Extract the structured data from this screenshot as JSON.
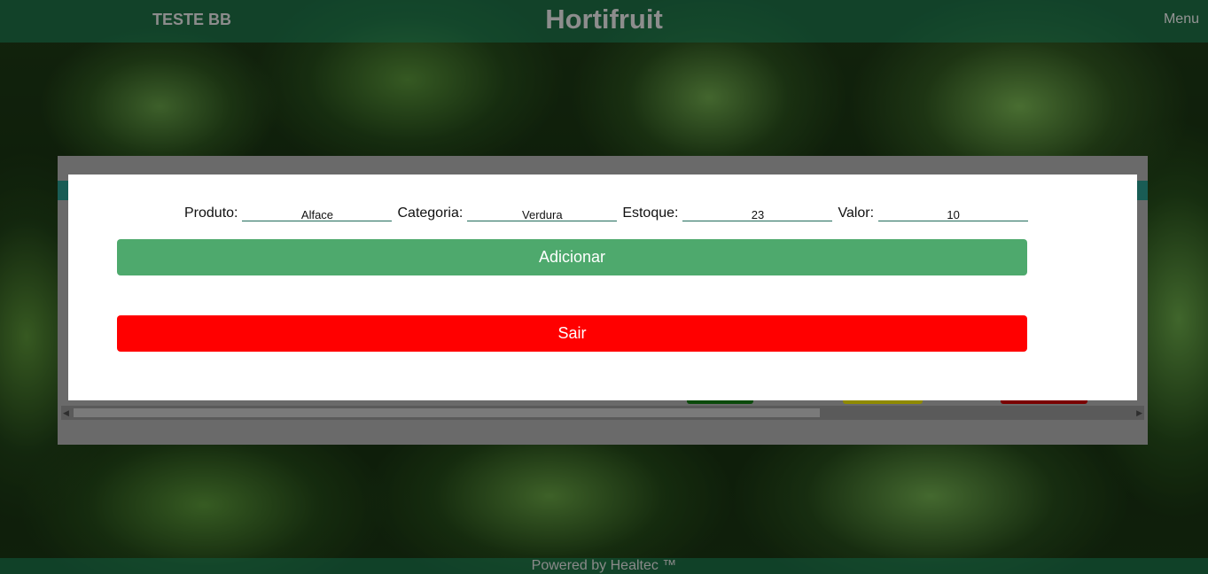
{
  "header": {
    "left_label": "TESTE BB",
    "title": "Hortifruit",
    "menu_label": "Menu"
  },
  "form": {
    "fields": [
      {
        "label": "Produto:",
        "value": "Alface"
      },
      {
        "label": "Categoria:",
        "value": "Verdura"
      },
      {
        "label": "Estoque:",
        "value": "23"
      },
      {
        "label": "Valor:",
        "value": "10"
      }
    ],
    "add_label": "Adicionar",
    "exit_label": "Sair"
  },
  "footer": {
    "text": "Powered by Healtec ™"
  },
  "colors": {
    "add_button": "#4ea96d",
    "exit_button": "#ff0000",
    "header_bar": "#125c42"
  }
}
